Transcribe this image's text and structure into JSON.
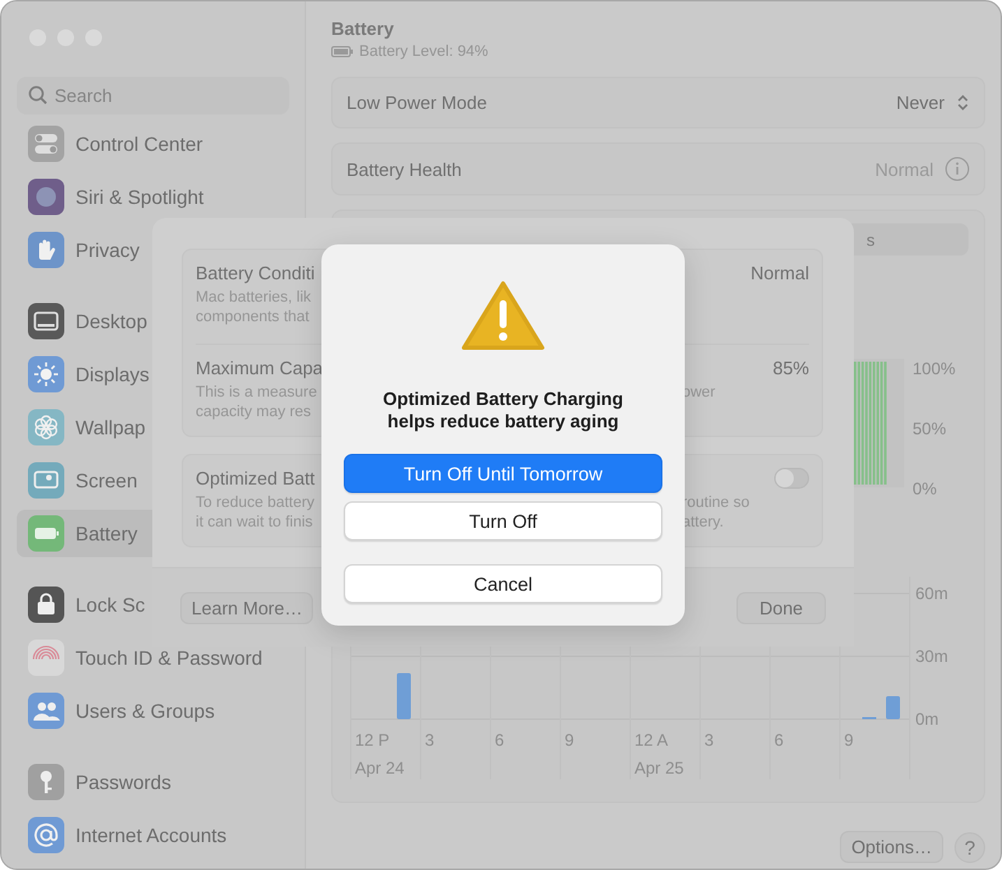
{
  "sidebar": {
    "search": {
      "placeholder": "Search"
    },
    "groups": [
      [
        {
          "label": "Control Center",
          "selected": false
        },
        {
          "label": "Siri & Spotlight",
          "selected": false
        },
        {
          "label": "Privacy",
          "selected": false
        }
      ],
      [
        {
          "label": "Desktop",
          "selected": false
        },
        {
          "label": "Displays",
          "selected": false
        },
        {
          "label": "Wallpap",
          "selected": false
        },
        {
          "label": "Screen",
          "selected": false
        },
        {
          "label": "Battery",
          "selected": true
        }
      ],
      [
        {
          "label": "Lock Sc",
          "selected": false
        },
        {
          "label": "Touch ID & Password",
          "selected": false
        },
        {
          "label": "Users & Groups",
          "selected": false
        }
      ],
      [
        {
          "label": "Passwords",
          "selected": false
        },
        {
          "label": "Internet Accounts",
          "selected": false
        }
      ]
    ]
  },
  "content": {
    "title": "Battery",
    "battery_level": "Battery Level: 94%",
    "settings": [
      {
        "label": "Low Power Mode",
        "value": "Never",
        "kind": "popup"
      },
      {
        "label": "Battery Health",
        "value": "Normal",
        "kind": "info"
      }
    ],
    "segment_fragment": "s",
    "level_chart": {
      "ticks": [
        "100%",
        "50%",
        "0%"
      ]
    },
    "usage_chart": {
      "hour_labels": [
        "12 P",
        "3",
        "6",
        "9",
        "12 A",
        "3",
        "6",
        "9"
      ],
      "date_labels": [
        "Apr 24",
        "Apr 25"
      ],
      "scale_labels": [
        "60m",
        "30m",
        "0m"
      ]
    },
    "buttons": [
      "Options…",
      "?"
    ]
  },
  "sheet": {
    "groups": [
      [
        {
          "title": "Battery Conditi",
          "value": "Normal",
          "lines": [
            {
              "left": "Mac batteries, lik"
            },
            {
              "left": "components that"
            }
          ]
        },
        {
          "title": "Maximum Capa",
          "value": "85%",
          "lines": [
            {
              "left": "This is a measure",
              "right": "ower"
            },
            {
              "left": "capacity may res"
            }
          ]
        }
      ],
      [
        {
          "title": "Optimized Batt",
          "toggle": {
            "on": false
          },
          "lines": [
            {
              "left": "To reduce battery",
              "right": "routine so"
            },
            {
              "left": "it can wait to finis",
              "right": "attery."
            }
          ]
        }
      ]
    ],
    "buttons": [
      "Learn More…",
      "Done"
    ]
  },
  "alert": {
    "title": "Optimized Battery Charging helps reduce battery aging",
    "buttons": [
      {
        "label": "Turn Off Until Tomorrow",
        "kind": "default"
      },
      {
        "label": "Turn Off",
        "kind": "normal"
      },
      {
        "label": "Cancel",
        "kind": "cancel"
      }
    ]
  }
}
